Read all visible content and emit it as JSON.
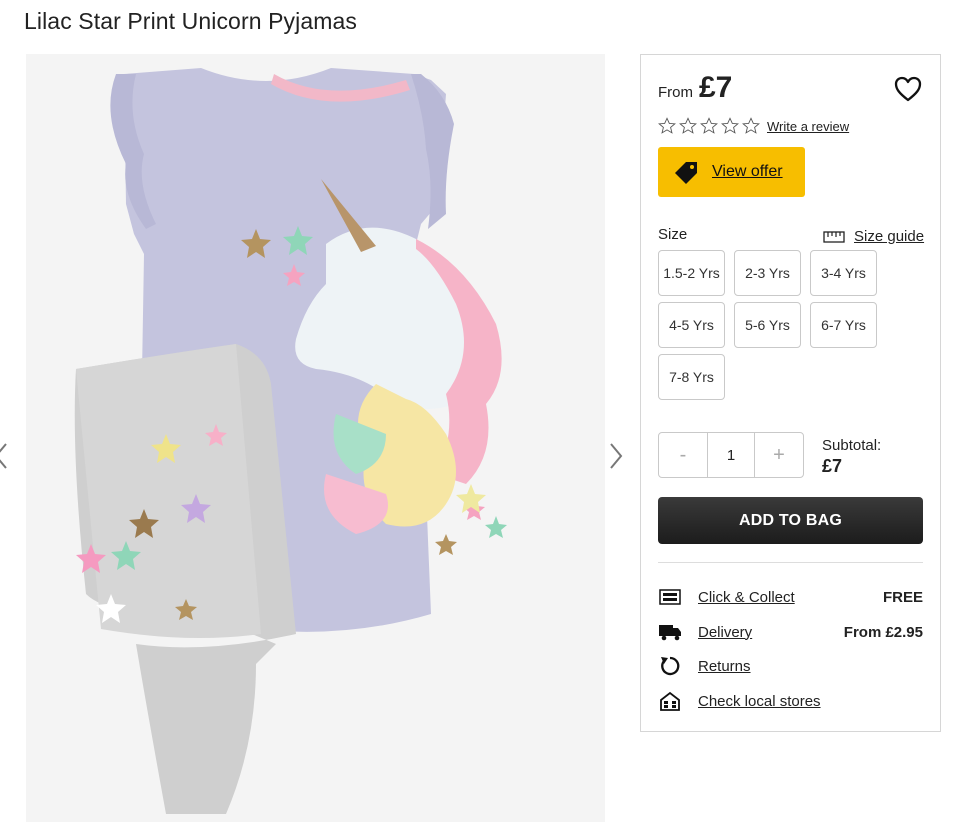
{
  "product": {
    "title": "Lilac Star Print Unicorn Pyjamas"
  },
  "price": {
    "from_label": "From",
    "value": "£7"
  },
  "reviews": {
    "rating": 0,
    "max": 5,
    "write_label": "Write a review"
  },
  "offer": {
    "label": "View offer",
    "color": "#f7be00"
  },
  "size": {
    "label": "Size",
    "guide_label": "Size guide",
    "options": [
      "1.5-2 Yrs",
      "2-3 Yrs",
      "3-4 Yrs",
      "4-5 Yrs",
      "5-6 Yrs",
      "6-7 Yrs",
      "7-8 Yrs"
    ]
  },
  "quantity": {
    "minus": "-",
    "value": "1",
    "plus": "+"
  },
  "subtotal": {
    "label": "Subtotal:",
    "value": "£7"
  },
  "add_to_bag": "ADD TO BAG",
  "services": [
    {
      "icon": "click-collect-icon",
      "label": "Click & Collect",
      "value": "FREE"
    },
    {
      "icon": "delivery-truck-icon",
      "label": "Delivery",
      "value": "From £2.95"
    },
    {
      "icon": "returns-icon",
      "label": "Returns",
      "value": ""
    },
    {
      "icon": "store-icon",
      "label": "Check local stores",
      "value": ""
    }
  ],
  "gallery": {
    "prev_icon": "chevron-left-icon",
    "next_icon": "chevron-right-icon"
  }
}
